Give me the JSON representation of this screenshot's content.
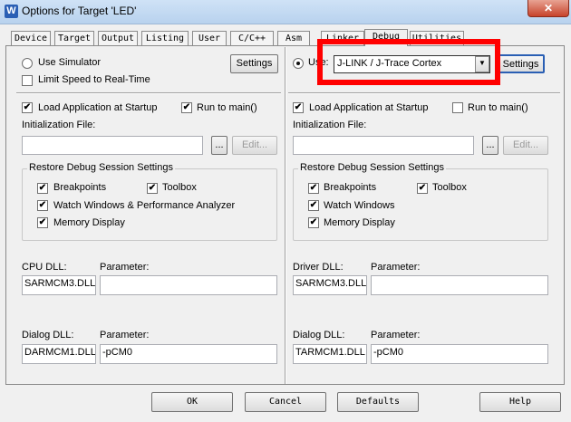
{
  "window": {
    "title": "Options for Target 'LED'",
    "close_label": "✕"
  },
  "tabs": [
    {
      "label": "Device"
    },
    {
      "label": "Target"
    },
    {
      "label": "Output"
    },
    {
      "label": "Listing"
    },
    {
      "label": "User"
    },
    {
      "label": "C/C++"
    },
    {
      "label": "Asm"
    },
    {
      "label": "Linker"
    },
    {
      "label": "Debug"
    },
    {
      "label": "Utilities"
    }
  ],
  "active_tab": "Debug",
  "left": {
    "use_simulator": "Use Simulator",
    "limit_speed": "Limit Speed to Real-Time",
    "settings": "Settings",
    "load_app": "Load Application at Startup",
    "run_to_main": "Run to main()",
    "init_file": "Initialization File:",
    "init_value": "",
    "browse": "...",
    "edit": "Edit...",
    "restore_group": "Restore Debug Session Settings",
    "breakpoints": "Breakpoints",
    "toolbox": "Toolbox",
    "watch": "Watch Windows & Performance Analyzer",
    "memory": "Memory Display",
    "cpu_dll_label": "CPU DLL:",
    "cpu_dll_value": "SARMCM3.DLL",
    "param_label": "Parameter:",
    "cpu_param_value": "",
    "dialog_dll_label": "Dialog DLL:",
    "dialog_dll_value": "DARMCM1.DLL",
    "dialog_param_value": "-pCM0"
  },
  "right": {
    "use_label": "Use:",
    "driver_selected": "J-LINK / J-Trace Cortex",
    "settings": "Settings",
    "load_app": "Load Application at Startup",
    "run_to_main": "Run to main()",
    "init_file": "Initialization File:",
    "init_value": "",
    "browse": "...",
    "edit": "Edit...",
    "restore_group": "Restore Debug Session Settings",
    "breakpoints": "Breakpoints",
    "toolbox": "Toolbox",
    "watch": "Watch Windows",
    "memory": "Memory Display",
    "driver_dll_label": "Driver DLL:",
    "driver_dll_value": "SARMCM3.DLL",
    "param_label": "Parameter:",
    "driver_param_value": "",
    "dialog_dll_label": "Dialog DLL:",
    "dialog_dll_value": "TARMCM1.DLL",
    "dialog_param_value": "-pCM0"
  },
  "footer": {
    "ok": "OK",
    "cancel": "Cancel",
    "defaults": "Defaults",
    "help": "Help"
  },
  "check_mark": "✔",
  "highlight_color": "#ff0000"
}
